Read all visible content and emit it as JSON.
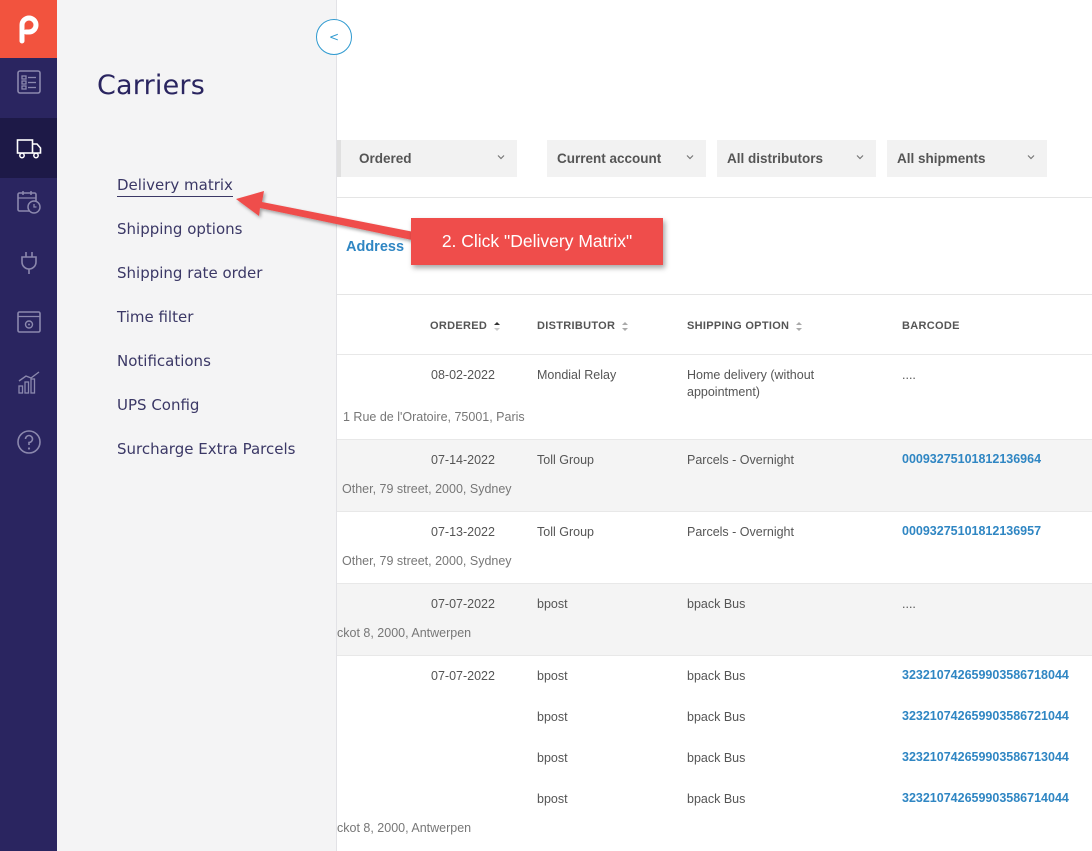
{
  "panel": {
    "title": "Carriers",
    "collapse_label": "<",
    "items": [
      {
        "label": "Delivery matrix"
      },
      {
        "label": "Shipping options"
      },
      {
        "label": "Shipping rate order"
      },
      {
        "label": "Time filter"
      },
      {
        "label": "Notifications"
      },
      {
        "label": "UPS Config"
      },
      {
        "label": "Surcharge Extra Parcels"
      }
    ]
  },
  "rail": {
    "icons": [
      "logo-icon",
      "orders-icon",
      "truck-icon",
      "calendar-clock-icon",
      "plug-icon",
      "settings-window-icon",
      "analytics-icon",
      "help-icon"
    ],
    "active": "truck-icon"
  },
  "filters": {
    "ordered": "Ordered",
    "account": "Current account",
    "distributors": "All distributors",
    "shipments": "All shipments"
  },
  "tab": {
    "address": "Address"
  },
  "table": {
    "headers": {
      "ordered": "ORDERED",
      "distributor": "DISTRIBUTOR",
      "shipping": "SHIPPING OPTION",
      "barcode": "BARCODE"
    },
    "rows": [
      {
        "ordered": "08-02-2022",
        "distributor": "Mondial Relay",
        "shipping": "Home delivery (without appointment)",
        "barcode": "....",
        "address": "1 Rue de l'Oratoire, 75001, Paris"
      },
      {
        "ordered": "07-14-2022",
        "distributor": "Toll Group",
        "shipping": "Parcels - Overnight",
        "barcode": "00093275101812136964",
        "address": "Other, 79 street, 2000, Sydney"
      },
      {
        "ordered": "07-13-2022",
        "distributor": "Toll Group",
        "shipping": "Parcels - Overnight",
        "barcode": "00093275101812136957",
        "address": "Other, 79 street, 2000, Sydney"
      },
      {
        "ordered": "07-07-2022",
        "distributor": "bpost",
        "shipping": "bpack Bus",
        "barcode": "....",
        "address": "ckot 8, 2000, Antwerpen"
      },
      {
        "ordered": "07-07-2022",
        "address": "ckot 8, 2000, Antwerpen",
        "parcels": [
          {
            "distributor": "bpost",
            "shipping": "bpack Bus",
            "barcode": "323210742659903586718044"
          },
          {
            "distributor": "bpost",
            "shipping": "bpack Bus",
            "barcode": "323210742659903586721044"
          },
          {
            "distributor": "bpost",
            "shipping": "bpack Bus",
            "barcode": "323210742659903586713044"
          },
          {
            "distributor": "bpost",
            "shipping": "bpack Bus",
            "barcode": "323210742659903586714044"
          }
        ]
      }
    ]
  },
  "callout": {
    "text": "2. Click \"Delivery Matrix\""
  },
  "colors": {
    "rail": "#2a2560",
    "logo": "#f2533e",
    "link": "#2f86c3",
    "callout": "#ef4d4b"
  }
}
